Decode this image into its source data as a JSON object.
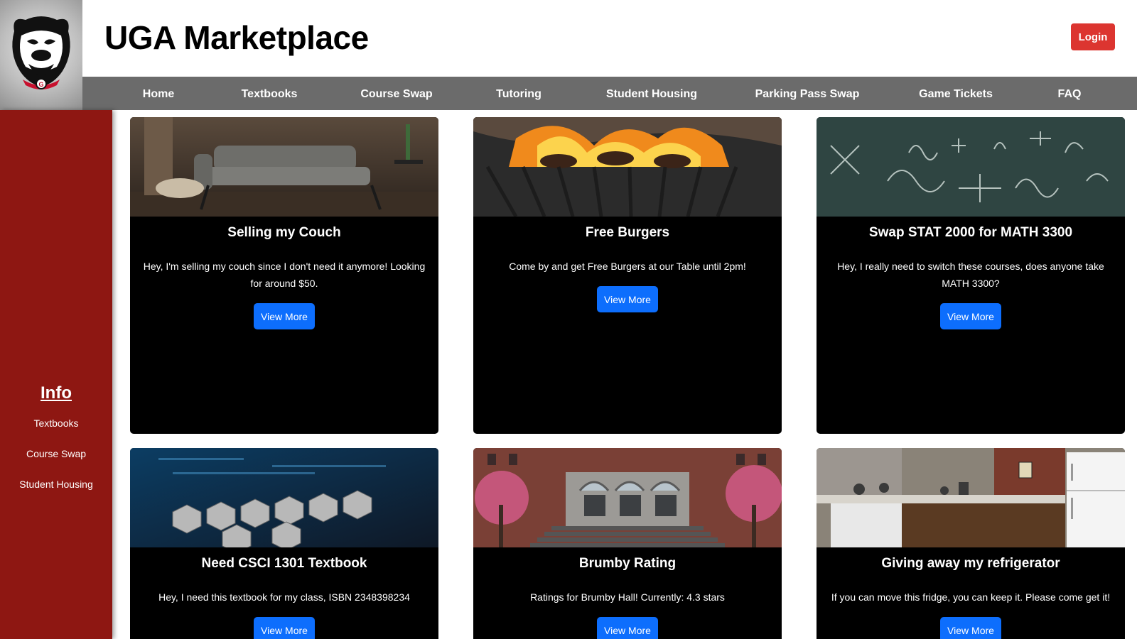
{
  "header": {
    "title": "UGA Marketplace",
    "login_label": "Login"
  },
  "nav": {
    "items": [
      "Home",
      "Textbooks",
      "Course Swap",
      "Tutoring",
      "Student Housing",
      "Parking Pass Swap",
      "Game Tickets",
      "FAQ"
    ]
  },
  "sidebar": {
    "title": "Info",
    "links": [
      "Textbooks",
      "Course Swap",
      "Student Housing"
    ]
  },
  "cards": [
    {
      "title": "Selling my Couch",
      "text": "Hey, I'm selling my couch since I don't need it anymore! Looking for around $50.",
      "button": "View More",
      "image": "couch-photo"
    },
    {
      "title": "Free Burgers",
      "text": "Come by and get Free Burgers at our Table until 2pm!",
      "button": "View More",
      "image": "grill-photo"
    },
    {
      "title": "Swap STAT 2000 for MATH 3300",
      "text": "Hey, I really need to switch these courses, does anyone take MATH 3300?",
      "button": "View More",
      "image": "chalkboard-math-photo"
    },
    {
      "title": "Need CSCI 1301 Textbook",
      "text": "Hey, I need this textbook for my class, ISBN 2348398234",
      "button": "View More",
      "image": "tech-hexagons-photo"
    },
    {
      "title": "Brumby Rating",
      "text": "Ratings for Brumby Hall! Currently: 4.3 stars",
      "button": "View More",
      "image": "dorm-building-photo"
    },
    {
      "title": "Giving away my refrigerator",
      "text": "If you can move this fridge, you can keep it. Please come get it!",
      "button": "View More",
      "image": "kitchen-fridge-photo"
    }
  ],
  "colors": {
    "sidebar": "#8e1712",
    "navbar": "#6b6b6b",
    "login": "#dc3530",
    "button": "#0d6efd",
    "card": "#000000"
  }
}
